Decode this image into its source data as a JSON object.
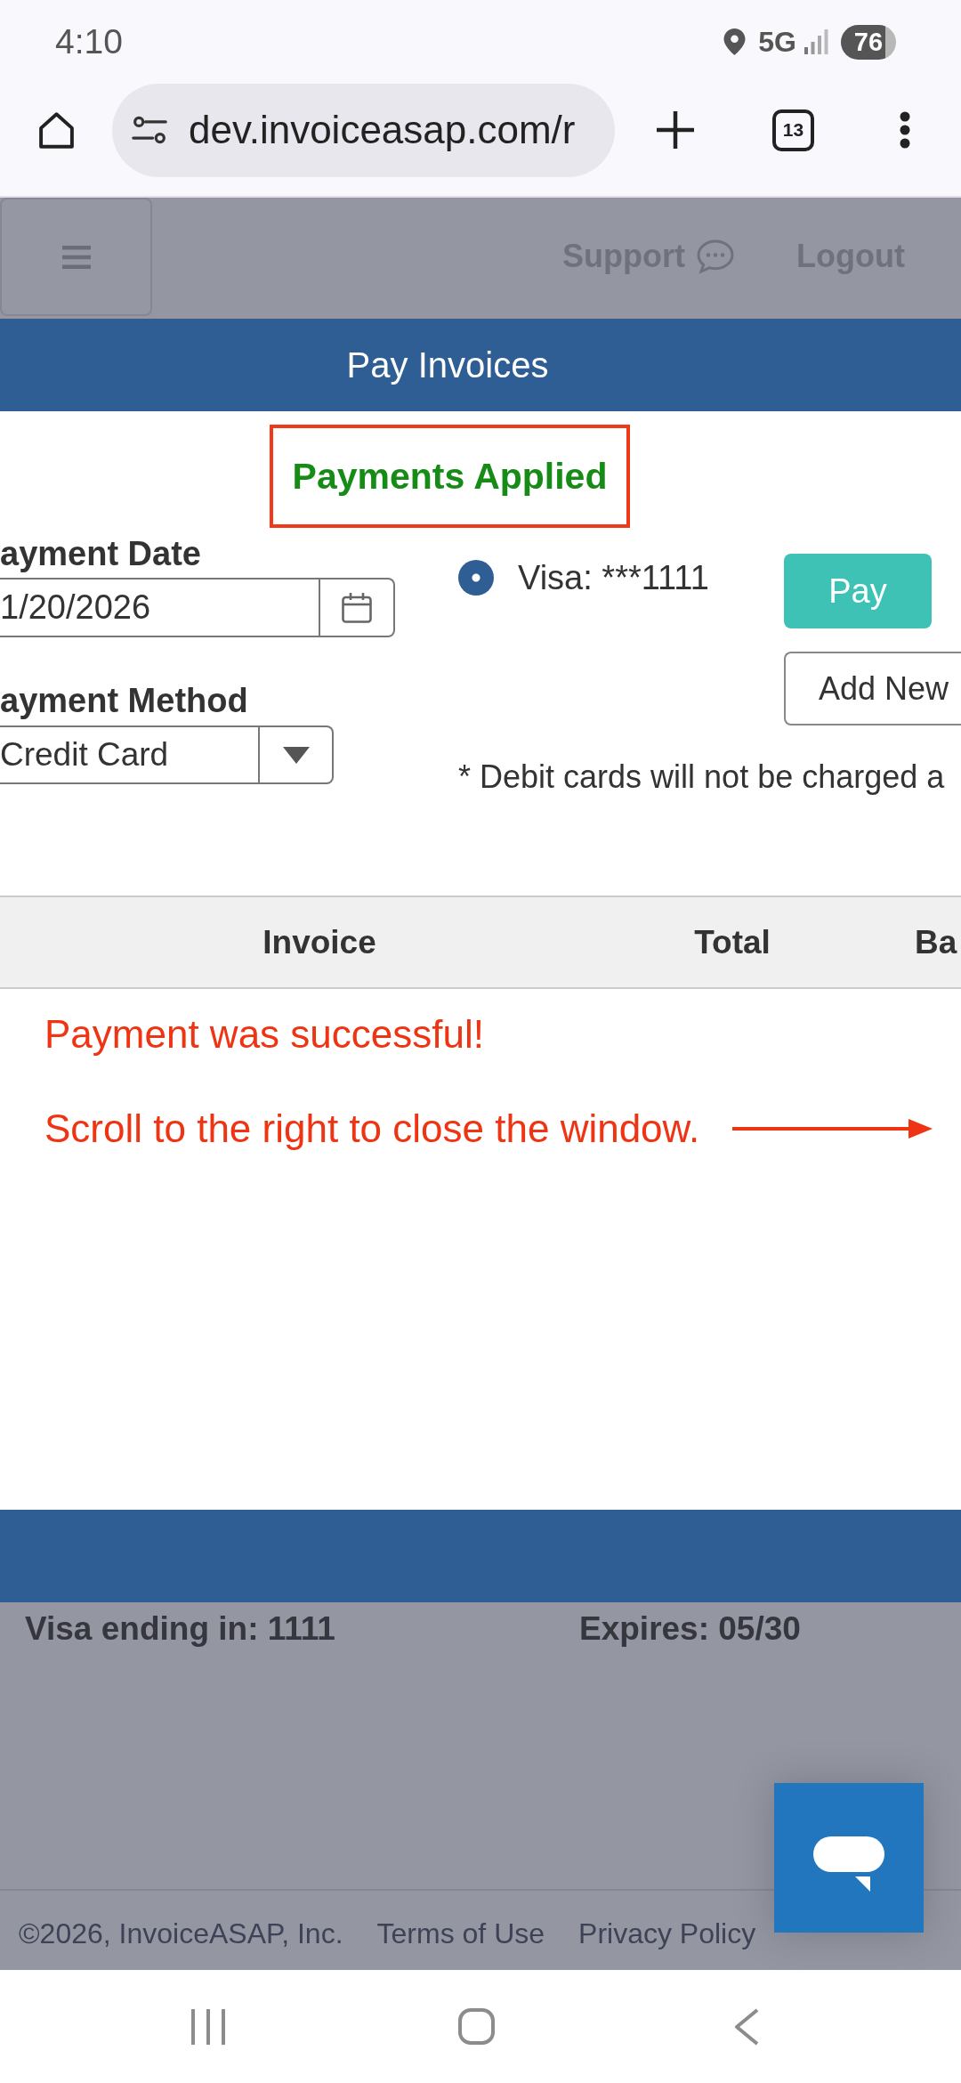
{
  "status_bar": {
    "time": "4:10",
    "network": "5G",
    "battery": "76"
  },
  "browser": {
    "url": "dev.invoiceasap.com/r",
    "tab_count": "13"
  },
  "app_header": {
    "links": [
      {
        "label": "Support",
        "kind": "chat"
      },
      {
        "label": "Logout",
        "kind": "plain"
      }
    ]
  },
  "dialog": {
    "title": "Pay Invoices",
    "status_message": "Payments Applied",
    "fields": [
      {
        "label": "ayment Date",
        "value": "1/20/2026",
        "kind": "date"
      },
      {
        "label": "ayment Method",
        "value": "Credit Card",
        "kind": "select"
      }
    ],
    "payment_options": [
      {
        "label": "Visa: ***1111",
        "selected": true
      }
    ],
    "buttons": [
      {
        "label": "Pay",
        "kind": "primary"
      },
      {
        "label": "Add New",
        "kind": "secondary"
      }
    ],
    "note": "* Debit cards will not be charged a",
    "table": {
      "columns": [
        "Invoice",
        "Total",
        "Ba"
      ]
    },
    "annotations": [
      {
        "text": "Payment was successful!",
        "kind": "text"
      },
      {
        "text": "Scroll to the right to close the window.",
        "kind": "arrow"
      }
    ]
  },
  "saved_card": {
    "card": "Visa ending in: 1111",
    "expires": "Expires: 05/30"
  },
  "footer": {
    "copyright": "©2026, InvoiceASAP, Inc.",
    "links": [
      "Terms of Use",
      "Privacy Policy"
    ]
  }
}
